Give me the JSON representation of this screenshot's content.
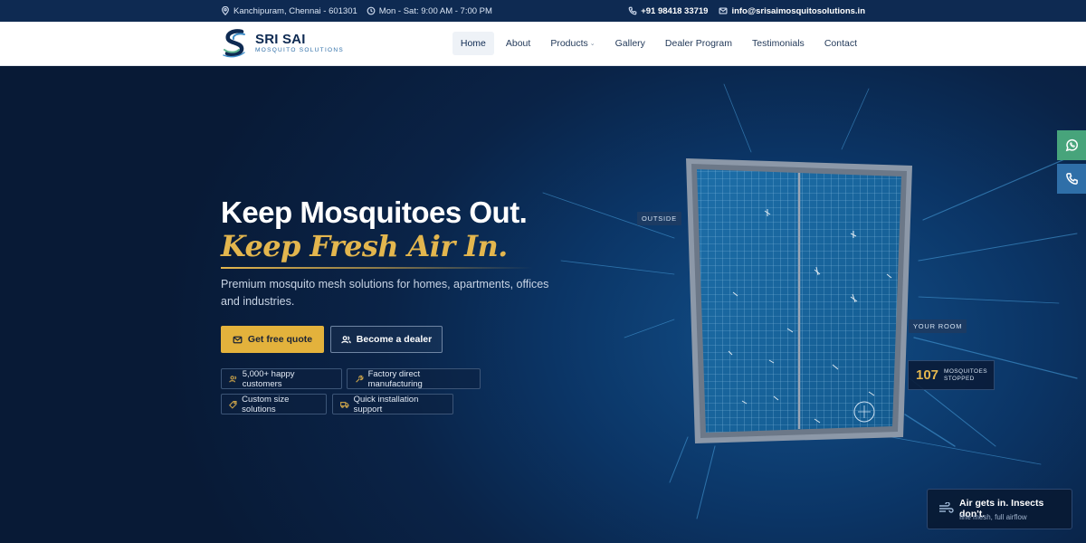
{
  "topbar": {
    "location": "Kanchipuram, Chennai - 601301",
    "hours": "Mon - Sat: 9:00 AM - 7:00 PM",
    "phone": "+91 98418 33719",
    "email": "info@srisaimosquitosolutions.in"
  },
  "brand": {
    "name": "SRI SAI",
    "tagline": "MOSQUITO SOLUTIONS"
  },
  "nav": {
    "items": [
      {
        "label": "Home",
        "active": true
      },
      {
        "label": "About"
      },
      {
        "label": "Products",
        "has_dropdown": true
      },
      {
        "label": "Gallery"
      },
      {
        "label": "Dealer Program"
      },
      {
        "label": "Testimonials"
      },
      {
        "label": "Contact"
      }
    ]
  },
  "hero": {
    "title_line1": "Keep Mosquitoes Out.",
    "title_line2": "Keep Fresh Air In.",
    "description": "Premium mosquito mesh solutions for homes, apartments, offices and industries.",
    "cta_primary": "Get free quote",
    "cta_secondary": "Become a dealer",
    "badges": [
      {
        "label": "5,000+ happy customers",
        "icon": "users-icon"
      },
      {
        "label": "Factory direct manufacturing",
        "icon": "wrench-icon"
      },
      {
        "label": "Custom size solutions",
        "icon": "tag-icon"
      },
      {
        "label": "Quick installation support",
        "icon": "truck-icon"
      }
    ]
  },
  "visual": {
    "label_outside": "OUTSIDE",
    "label_room": "YOUR ROOM",
    "stat_number": "107",
    "stat_label": "MOSQUITOES STOPPED",
    "air_title": "Air gets in. Insects don't.",
    "air_subtitle": "fine mesh, full airflow"
  },
  "floating": {
    "whatsapp_icon": "whatsapp-icon",
    "phone_icon": "phone-icon"
  },
  "colors": {
    "topbar_bg": "#0e2a52",
    "accent_gold": "#e3b23c",
    "whatsapp_green": "#47a47b",
    "call_blue": "#2f6fa8"
  }
}
